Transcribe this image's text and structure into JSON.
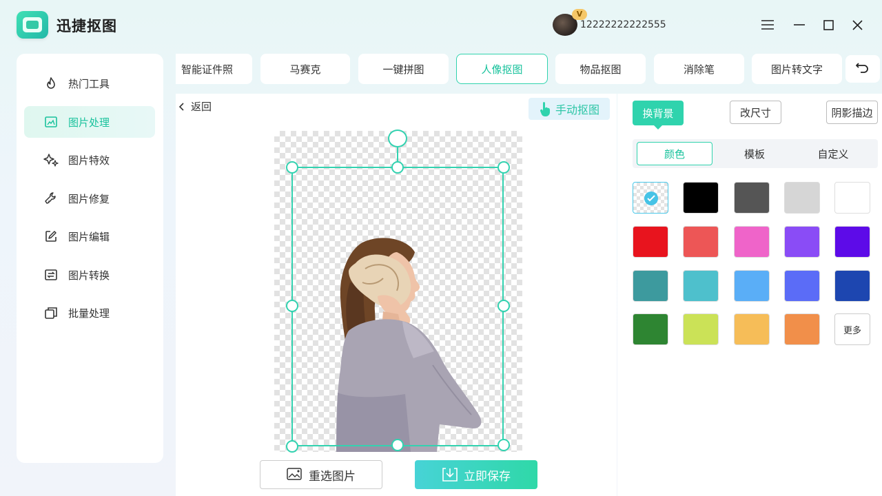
{
  "app": {
    "title": "迅捷抠图"
  },
  "user": {
    "name": "12222222222555",
    "badge": "V"
  },
  "sidebar": {
    "items": [
      {
        "label": "热门工具",
        "icon": "flame-icon"
      },
      {
        "label": "图片处理",
        "icon": "image-edit-icon"
      },
      {
        "label": "图片特效",
        "icon": "sparkle-icon"
      },
      {
        "label": "图片修复",
        "icon": "wrench-icon"
      },
      {
        "label": "图片编辑",
        "icon": "pencil-square-icon"
      },
      {
        "label": "图片转换",
        "icon": "convert-icon"
      },
      {
        "label": "批量处理",
        "icon": "stack-icon"
      }
    ],
    "active_index": 1
  },
  "tabs": {
    "items": [
      "智能证件照",
      "马赛克",
      "一键拼图",
      "人像抠图",
      "物品抠图",
      "消除笔",
      "图片转文字"
    ],
    "active": "人像抠图"
  },
  "canvas": {
    "back_label": "返回",
    "manual_label": "手动抠图",
    "reselect_label": "重选图片",
    "save_label": "立即保存"
  },
  "right_panel": {
    "tabs": [
      "换背景",
      "改尺寸",
      "阴影描边"
    ],
    "segments": [
      "颜色",
      "模板",
      "自定义"
    ],
    "active_segment": "颜色",
    "swatches": [
      [
        "transparent",
        "#000000",
        "#555555",
        "#d6d6d6",
        "#ffffff"
      ],
      [
        "#e8141e",
        "#ed5656",
        "#ef64c9",
        "#8a4cf6",
        "#5d0be8"
      ],
      [
        "#3d9a9e",
        "#4ec0cc",
        "#5aaef7",
        "#5b6cf7",
        "#1d46b0"
      ],
      [
        "#2e8532",
        "#cbe257",
        "#f6bd58",
        "#f18f4a"
      ]
    ],
    "more_label": "更多"
  },
  "colors": {
    "accent": "#2fd3ad",
    "accent_text": "#18c29c"
  }
}
